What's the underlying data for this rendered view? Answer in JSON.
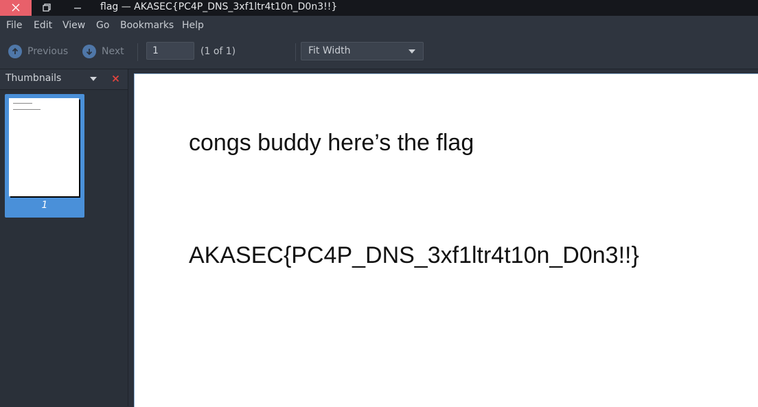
{
  "window": {
    "title": "flag — AKASEC{PC4P_DNS_3xf1ltr4t10n_D0n3!!}"
  },
  "menu": {
    "items": [
      {
        "label": "File"
      },
      {
        "label": "Edit"
      },
      {
        "label": "View"
      },
      {
        "label": "Go"
      },
      {
        "label": "Bookmarks"
      },
      {
        "label": "Help"
      }
    ]
  },
  "toolbar": {
    "previous_label": "Previous",
    "next_label": "Next",
    "page_value": "1",
    "page_count": "(1 of 1)",
    "zoom_value": "Fit Width"
  },
  "sidebar": {
    "title": "Thumbnails",
    "thumbnails": [
      {
        "page_label": "1"
      }
    ]
  },
  "document": {
    "line1": "congs buddy here’s the flag",
    "line2": "AKASEC{PC4P_DNS_3xf1ltr4t10n_D0n3!!}"
  },
  "colors": {
    "close_button": "#e8606a",
    "accent": "#4a90d9",
    "nav_icon": "#4f77a8"
  }
}
